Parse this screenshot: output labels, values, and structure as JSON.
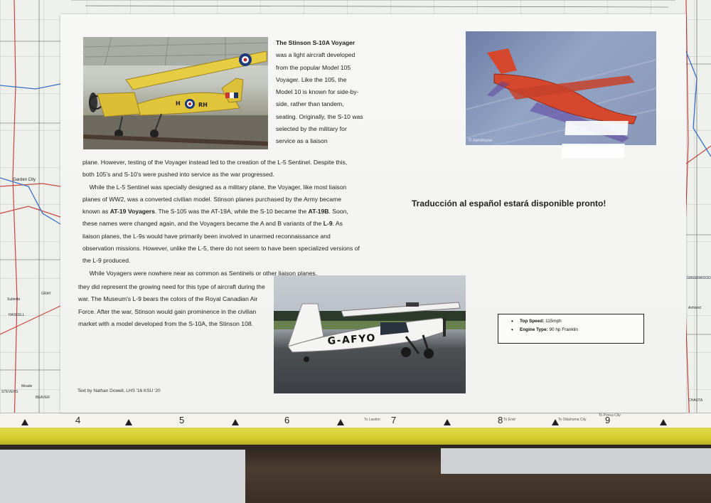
{
  "map": {
    "towns": [
      "Garden City",
      "Sublette",
      "HASKELL",
      "GRAY",
      "GREENWOOD",
      "Ashland",
      "Meade",
      "BEAVER",
      "STEVENS",
      "CHAUTA"
    ],
    "ruler": {
      "numbers": [
        "4",
        "5",
        "6",
        "7",
        "8",
        "9"
      ],
      "towns": [
        "To Lawton",
        "To Enid",
        "To Oklahoma City",
        "To Ponca City"
      ]
    }
  },
  "plaque": {
    "para_top": {
      "title": "The Stinson S-10A Voyager",
      "text": "was a light aircraft developed from the popular Model 105 Voyager. Like the 105, the Model 10 is known for side-by-side, rather than tandem, seating. Originally, the S-10 was selected by the military for service as a liaison"
    },
    "para_wide": {
      "line1": "plane. However, testing of the  Voyager instead led to the creation of the L-5 Sentinel. Despite this, both 105's and S-10's were pushed into service as the war progressed.",
      "line2a": "While the L-5 Sentinel was specially designed as a military plane, the Voyager, like most liaison planes of WW2, was a converted civilian model. Stinson planes purchased by the Army became known as",
      "bold_at19": "AT-19 Voyagers",
      "line2b": ". The S-105 was the AT-19A, while the S-10 became the",
      "bold_at19b": "AT-19B",
      "line2c": ". Soon, these names were changed again, and the Voyagers became the A and B variants of the",
      "bold_l9": "L-9",
      "line2d": ".  As liaison planes, the L-9s would have primarily been involved in unarmed reconnaissance and observation missions. However, unlike the L-5, there do not seem to have been specialized versions of the L-9 produced.",
      "line3": "While Voyagers were nowhere near as common as Sentinels or other liaison planes,"
    },
    "para_bottom": "they did represent the growing need for this type of aircraft during the war.  The Museum's L-9 bears the colors of the Royal Canadian Air Force. After the war, Stinson would gain prominence in the civilian market with a model developed from the S-10A, the Stinson 108.",
    "credit": "Text by Nathan Dowell, LHS '16 KSU '20",
    "spanish_note": "Traducción al español estará disponible pronto!",
    "photo_yellow": {
      "codes": [
        "RH",
        "H"
      ]
    },
    "photo_red": {
      "credit": "© Aeromuse"
    },
    "photo_white": {
      "registration": "G-AFYO"
    },
    "specs": [
      {
        "label": "Top Speed:",
        "value": "115mph"
      },
      {
        "label": "Engine Type:",
        "value": "90 hp Franklin"
      }
    ]
  },
  "colors": {
    "plaque": "#f4f4f2",
    "ruler_edge": "#d9d035",
    "yellow_plane": "#e0c43a",
    "red_plane": "#d5482e"
  }
}
